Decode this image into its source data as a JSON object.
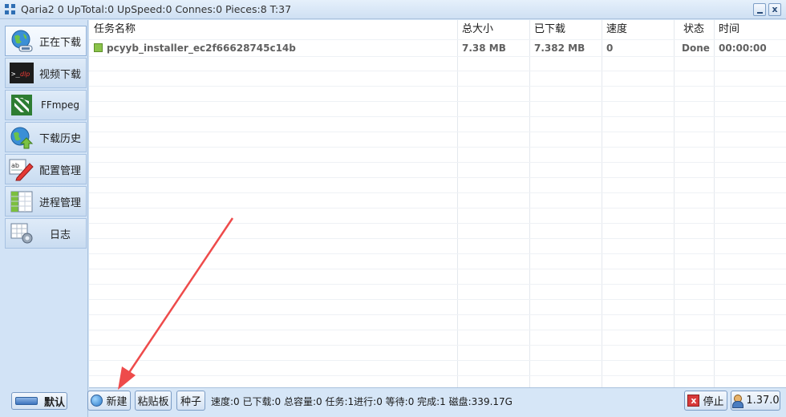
{
  "window": {
    "title": "Qaria2 0 UpTotal:0 UpSpeed:0 Connes:0 Pieces:8 T:37",
    "close_glyph": "x"
  },
  "sidebar": {
    "items": [
      {
        "label": "正在下载",
        "icon": "globe-download-icon",
        "active": true
      },
      {
        "label": "视频下载",
        "icon": "ytdlp-terminal-icon",
        "active": false
      },
      {
        "label": "FFmpeg",
        "icon": "ffmpeg-icon",
        "active": false
      },
      {
        "label": "下载历史",
        "icon": "globe-history-icon",
        "active": false
      },
      {
        "label": "配置管理",
        "icon": "edit-config-icon",
        "active": false
      },
      {
        "label": "进程管理",
        "icon": "process-grid-icon",
        "active": false
      },
      {
        "label": "日志",
        "icon": "log-settings-icon",
        "active": false
      }
    ],
    "default_button": "默认"
  },
  "table": {
    "columns": [
      "任务名称",
      "总大小",
      "已下载",
      "速度",
      "状态",
      "时间"
    ],
    "rows": [
      {
        "name": "pcyyb_installer_ec2f66628745c14b",
        "size": "7.38 MB",
        "downloaded": "7.382 MB",
        "speed": "0",
        "status": "Done",
        "time": "00:00:00"
      }
    ]
  },
  "toolbar": {
    "new_label": "新建",
    "clipboard_label": "粘贴板",
    "seed_label": "种子",
    "status_text": "速度:0 已下载:0 总容量:0 任务:1进行:0 等待:0 完成:1 磁盘:339.17G",
    "stop_label": "停止",
    "version_label": "1.37.0"
  },
  "colors": {
    "accent": "#2f6fb4",
    "annotation_arrow": "#ee4b4b",
    "window_bg": "#d6e6f7"
  }
}
